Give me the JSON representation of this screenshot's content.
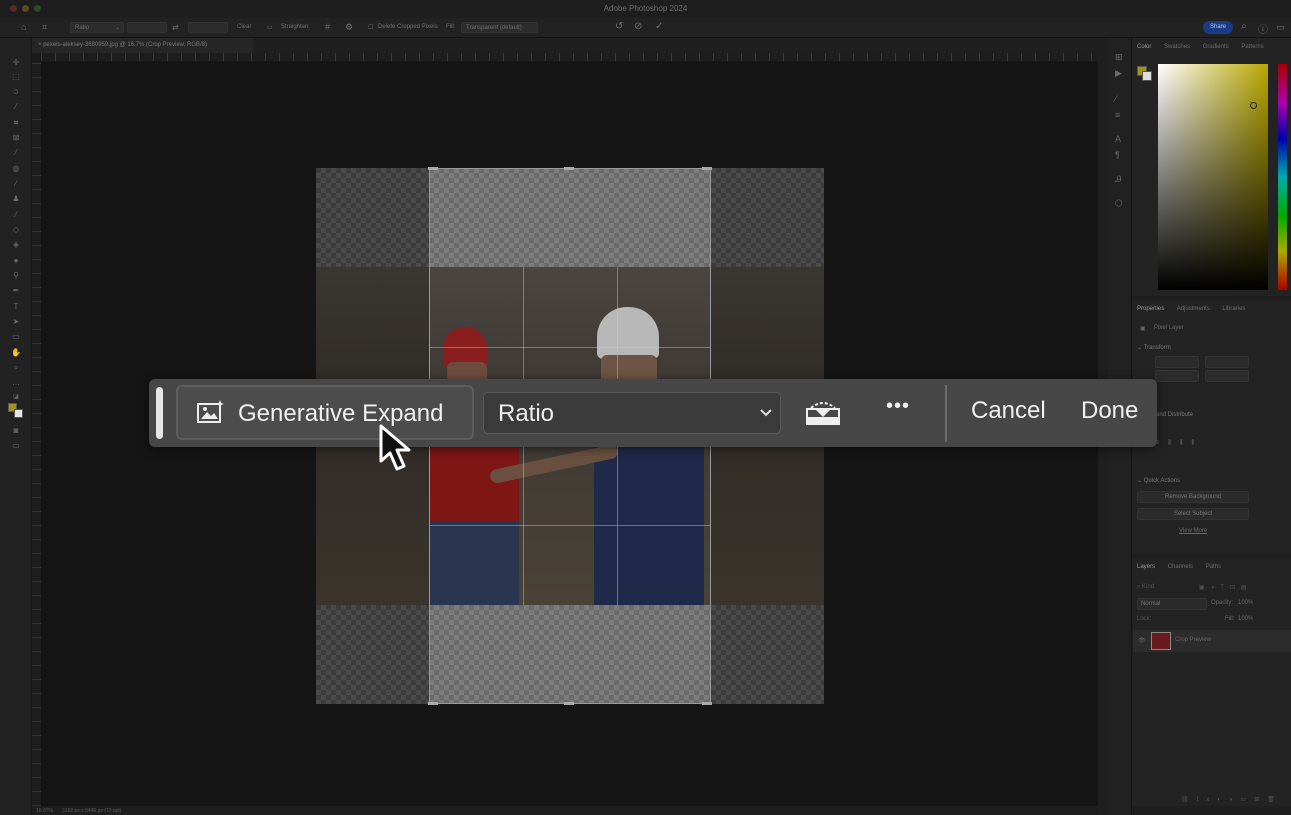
{
  "app": {
    "title": "Adobe Photoshop 2024"
  },
  "options_bar": {
    "ratio_label": "Ratio",
    "clear_label": "Clear",
    "straighten_label": "Straighten",
    "delete_cropped_label": "Delete Cropped Pixels",
    "fill_label": "Fill:",
    "fill_value": "Transparent (default)",
    "share_label": "Share"
  },
  "document": {
    "tab_label": "pexels-aleksey-3680959.jpg @ 16.7% (Crop Preview, RGB/8)"
  },
  "status_bar": {
    "zoom": "16.67%",
    "size": "3169 px x 5446 px (72 ppi)"
  },
  "contextual_task_bar": {
    "generative_expand_label": "Generative Expand",
    "ratio_value": "Ratio",
    "cancel_label": "Cancel",
    "done_label": "Done",
    "more_label": "•••"
  },
  "color_panel": {
    "tabs": [
      "Color",
      "Swatches",
      "Gradients",
      "Patterns"
    ]
  },
  "properties_panel": {
    "tabs": [
      "Properties",
      "Adjustments",
      "Libraries"
    ],
    "layer_type": "Pixel Layer",
    "transform_label": "Transform",
    "align_label": "n and Distribute",
    "quick_actions_label": "Quick Actions",
    "remove_bg_label": "Remove Background",
    "select_subject_label": "Select Subject",
    "view_more_label": "View More"
  },
  "layers_panel": {
    "tabs": [
      "Layers",
      "Channels",
      "Paths"
    ],
    "kind_placeholder": "Kind",
    "blend_mode": "Normal",
    "opacity_label": "Opacity:",
    "opacity_value": "100%",
    "lock_label": "Lock:",
    "fill_label": "Fill:",
    "fill_value": "100%",
    "layer_name": "Crop Preview"
  },
  "colors": {
    "accent": "#1b3b87",
    "foreground_swatch": "#a39419"
  }
}
